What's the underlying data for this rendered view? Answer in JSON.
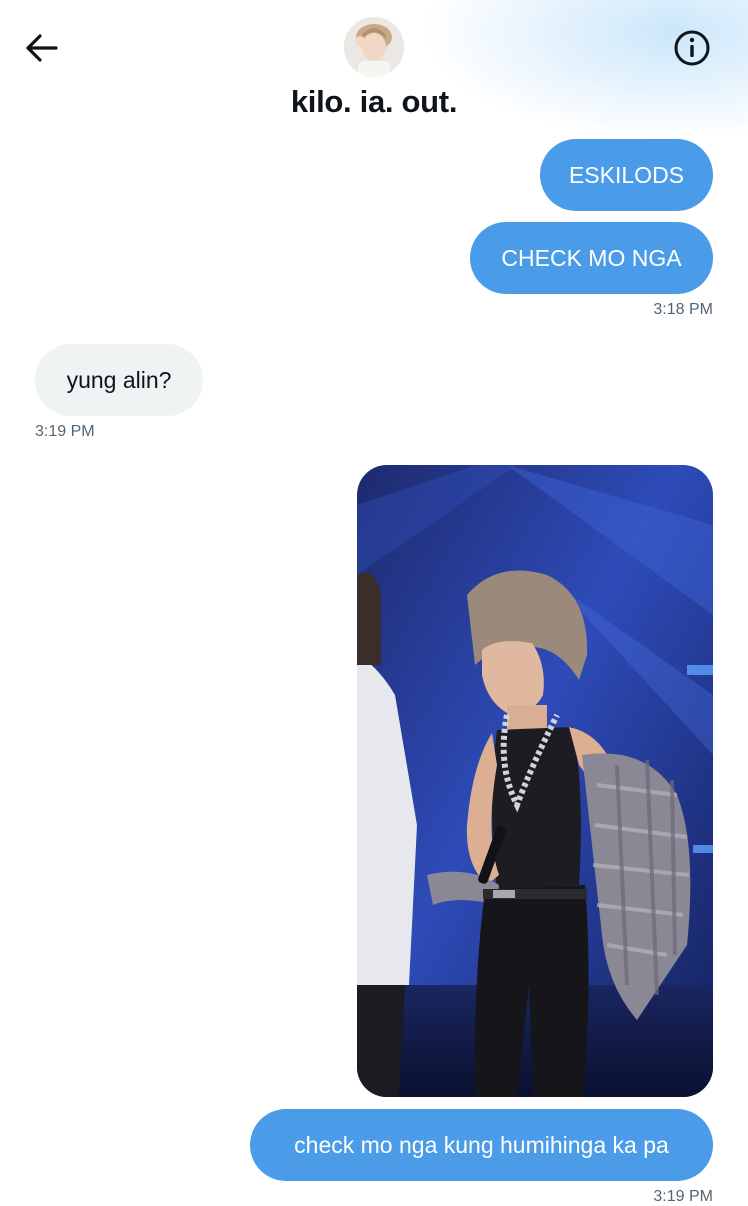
{
  "header": {
    "title": "kilo. ia. out.",
    "back_icon": "arrow-left-icon",
    "info_icon": "info-circle-icon"
  },
  "messages": [
    {
      "direction": "outgoing",
      "text": "ESKILODS"
    },
    {
      "direction": "outgoing",
      "text": "CHECK MO NGA",
      "time": "3:18 PM"
    },
    {
      "direction": "incoming",
      "text": "yung alin?",
      "time": "3:19 PM"
    },
    {
      "direction": "outgoing",
      "type": "image"
    },
    {
      "direction": "outgoing",
      "text": "check mo nga kung humihinga ka pa",
      "time": "3:19 PM"
    }
  ],
  "colors": {
    "outgoing_bubble": "#4a9be8",
    "incoming_bubble": "#eff3f4",
    "timestamp": "#536471"
  }
}
